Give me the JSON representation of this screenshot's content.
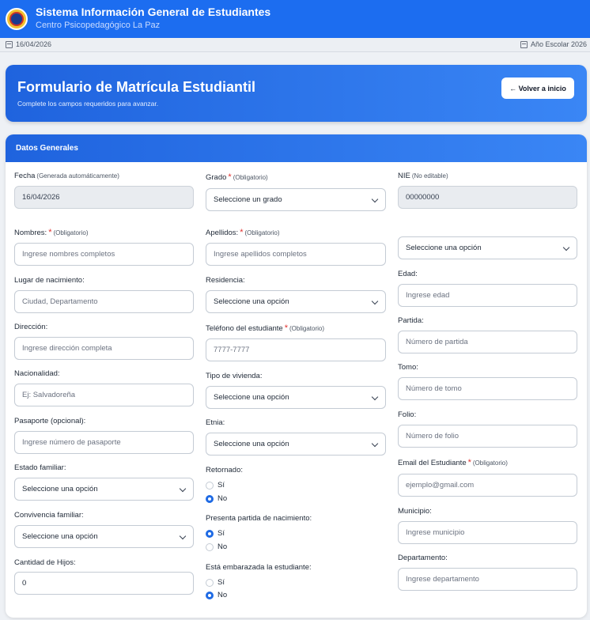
{
  "header": {
    "title": "Sistema Información General de Estudiantes",
    "subtitle": "Centro Psicopedagógico La Paz"
  },
  "statusbar": {
    "date": "16/04/2026",
    "school_year": "Año Escolar 2026"
  },
  "hero": {
    "title": "Formulario de Matrícula Estudiantil",
    "subtitle": "Complete los campos requeridos para avanzar.",
    "back_button": "← Volver a inicio"
  },
  "section": {
    "title": "Datos Generales"
  },
  "col1": {
    "fecha": {
      "label": "Fecha",
      "hint": "(Generada automáticamente)",
      "value": "16/04/2026"
    },
    "nombres": {
      "label": "Nombres:",
      "req": "*",
      "hint": "(Obligatorio)",
      "placeholder": "Ingrese nombres completos"
    },
    "lugar": {
      "label": "Lugar de nacimiento:",
      "placeholder": "Ciudad, Departamento"
    },
    "direccion": {
      "label": "Dirección:",
      "placeholder": "Ingrese dirección completa"
    },
    "nacionalidad": {
      "label": "Nacionalidad:",
      "placeholder": "Ej: Salvadoreña"
    },
    "pasaporte": {
      "label": "Pasaporte (opcional):",
      "placeholder": "Ingrese número de pasaporte"
    },
    "estado_familiar": {
      "label": "Estado familiar:",
      "value": "Seleccione una opción"
    },
    "convivencia": {
      "label": "Convivencia familiar:",
      "value": "Seleccione una opción"
    },
    "hijos": {
      "label": "Cantidad de Hijos:",
      "value": "0"
    }
  },
  "col2": {
    "grado": {
      "label": "Grado",
      "req": "*",
      "hint": "(Obligatorio)",
      "value": "Seleccione un grado"
    },
    "apellidos": {
      "label": "Apellidos:",
      "req": "*",
      "hint": "(Obligatorio)",
      "placeholder": "Ingrese apellidos completos"
    },
    "residencia": {
      "label": "Residencia:",
      "value": "Seleccione una opción"
    },
    "telefono": {
      "label": "Teléfono del estudiante",
      "req": "*",
      "hint": "(Obligatorio)",
      "placeholder": "7777-7777"
    },
    "vivienda": {
      "label": "Tipo de vivienda:",
      "value": "Seleccione una opción"
    },
    "etnia": {
      "label": "Etnia:",
      "value": "Seleccione una opción"
    },
    "retornado": {
      "label": "Retornado:",
      "option_yes": "Sí",
      "option_no": "No",
      "selected": "No"
    },
    "partida_presenta": {
      "label": "Presenta partida de nacimiento:",
      "option_yes": "Sí",
      "option_no": "No",
      "selected": "Sí"
    },
    "embarazada": {
      "label": "Está embarazada la estudiante:",
      "option_yes": "Sí",
      "option_no": "No",
      "selected": "No"
    }
  },
  "col3": {
    "nie": {
      "label": "NIE",
      "hint": "(No editable)",
      "value": "00000000"
    },
    "select_extra": {
      "value": "Seleccione una opción"
    },
    "edad": {
      "label": "Edad:",
      "placeholder": "Ingrese edad"
    },
    "partida": {
      "label": "Partida:",
      "placeholder": "Número de partida"
    },
    "tomo": {
      "label": "Tomo:",
      "placeholder": "Número de tomo"
    },
    "folio": {
      "label": "Folio:",
      "placeholder": "Número de folio"
    },
    "email": {
      "label": "Email del Estudiante",
      "req": "*",
      "hint": "(Obligatorio)",
      "placeholder": "ejemplo@gmail.com"
    },
    "municipio": {
      "label": "Municipio:",
      "placeholder": "Ingrese municipio"
    },
    "departamento": {
      "label": "Departamento:",
      "placeholder": "Ingrese departamento"
    }
  },
  "colors": {
    "primary": "#1c6df0",
    "required": "#e0322f",
    "radio_selected": "#1f6ae4"
  }
}
